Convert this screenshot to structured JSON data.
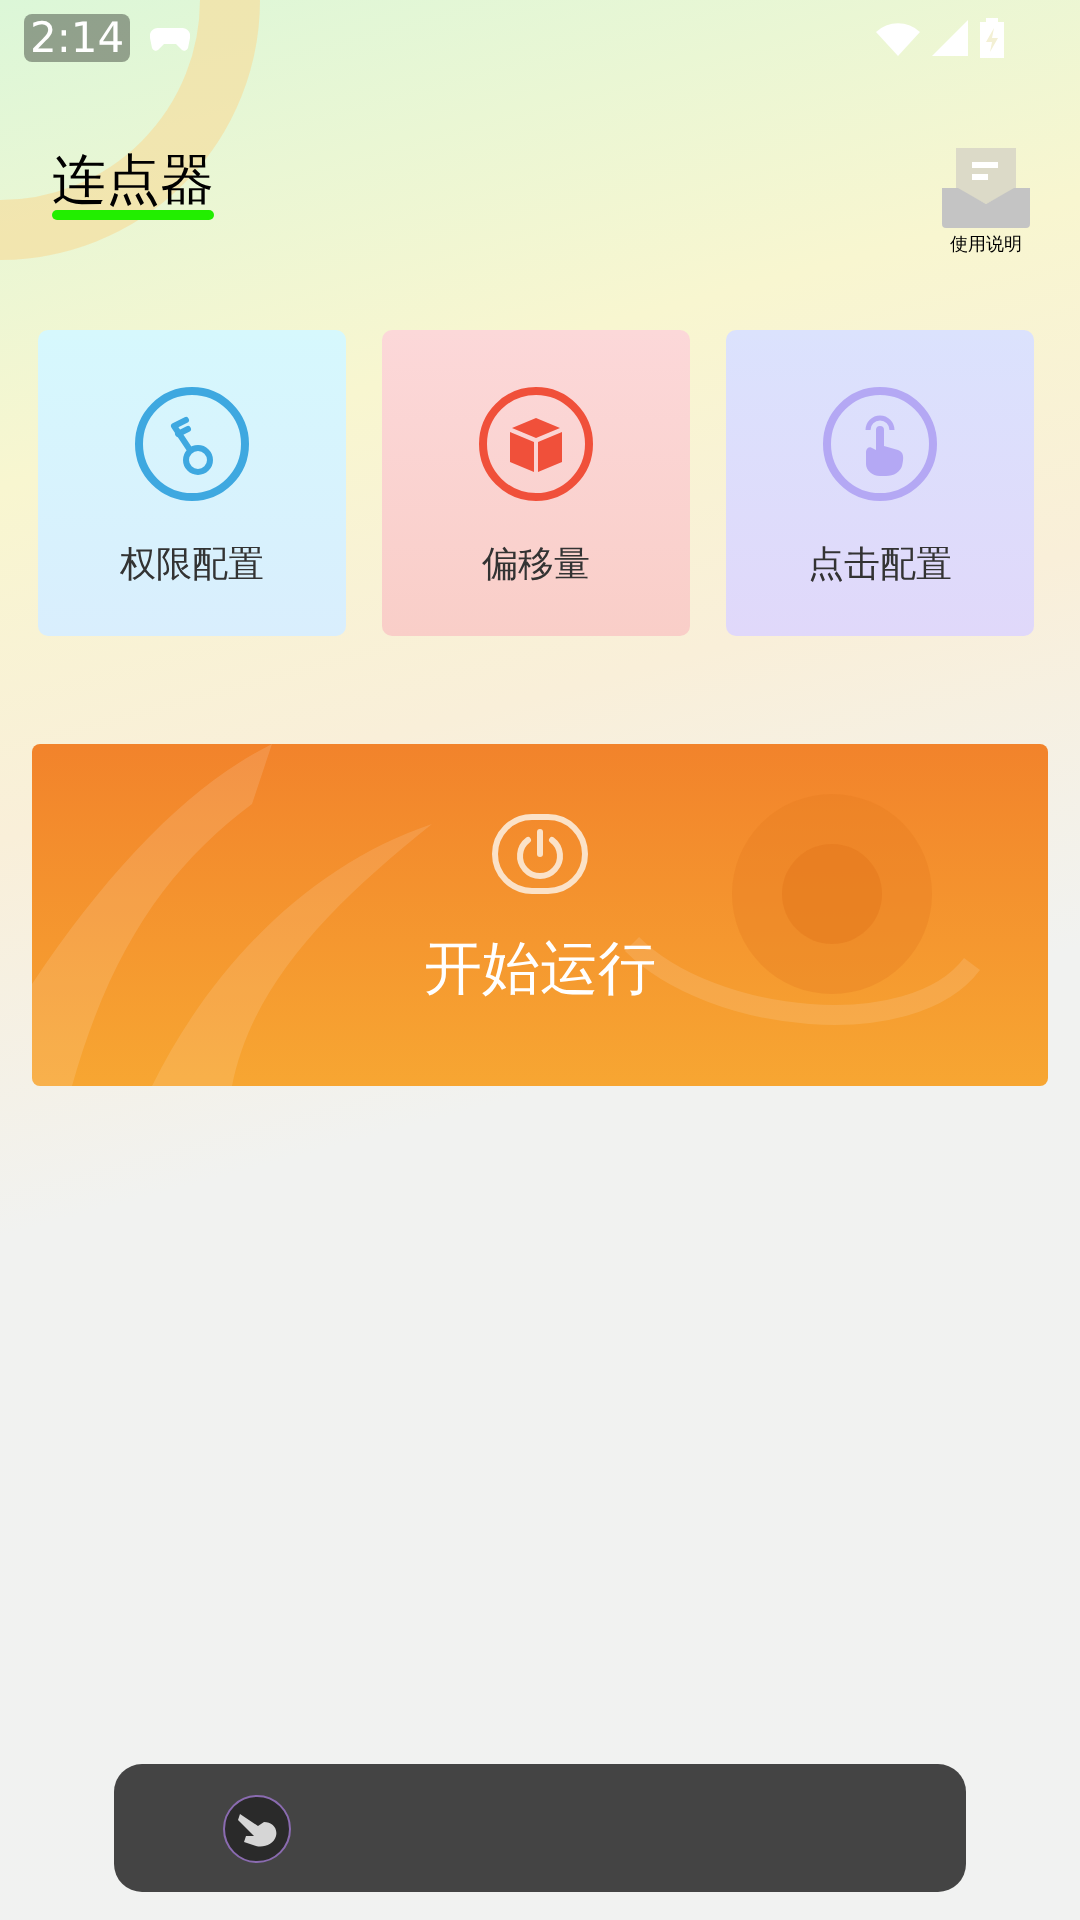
{
  "status_bar": {
    "time": "2:14"
  },
  "header": {
    "title": "连点器",
    "help_label": "使用说明"
  },
  "tiles": [
    {
      "kind": "key",
      "label": "权限配置",
      "color": "#3ea8e0"
    },
    {
      "kind": "cube",
      "label": "偏移量",
      "color": "#f0503a"
    },
    {
      "kind": "tap",
      "label": "点击配置",
      "color": "#b4a8f4"
    }
  ],
  "start_button": {
    "label": "开始运行"
  }
}
